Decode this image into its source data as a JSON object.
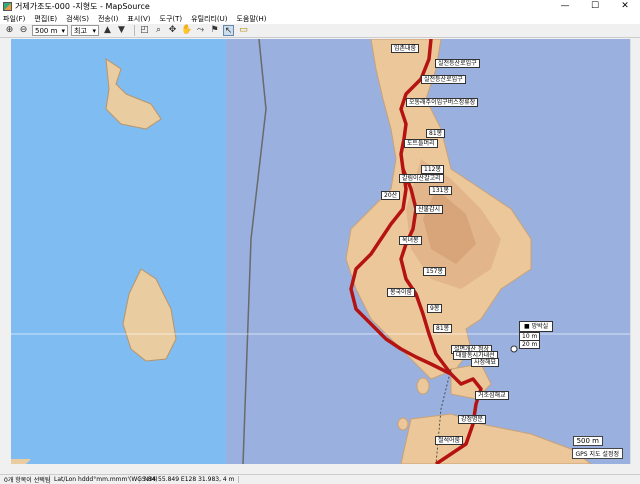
{
  "window": {
    "title": "거제가조도-000 -지형도 - MapSource",
    "min": "—",
    "max": "☐",
    "close": "✕"
  },
  "menu": [
    "파일(F)",
    "편집(E)",
    "검색(S)",
    "전송(I)",
    "표시(V)",
    "도구(T)",
    "유틸리티(U)",
    "도움말(H)"
  ],
  "toolbar": {
    "zoom_in": "⊕",
    "zoom_out": "⊖",
    "scale_value": "500 m",
    "detail_value": "최고"
  },
  "waypoints": [
    {
      "label": "임촌내룸"
    },
    {
      "label": "실전등산로입구"
    },
    {
      "label": "실전등산로입구"
    },
    {
      "label": "오동래주이입구버스정류장"
    },
    {
      "label": "81봉"
    },
    {
      "label": "도트들머리"
    },
    {
      "label": "112봉"
    },
    {
      "label": "갈림이산갈고리"
    },
    {
      "label": "131봉"
    },
    {
      "label": "20산"
    },
    {
      "label": "산불감시"
    },
    {
      "label": "옥녀봉"
    },
    {
      "label": "157봉"
    },
    {
      "label": "봉국이룸"
    },
    {
      "label": "9봉"
    },
    {
      "label": "81봉"
    },
    {
      "label": "설면개산 정상"
    },
    {
      "label": "대할동시가내선"
    },
    {
      "label": "사정해묘"
    },
    {
      "label": "거조섬해교"
    },
    {
      "label": "강정명문"
    },
    {
      "label": "철석어룸"
    }
  ],
  "callout": {
    "title": "망박실",
    "line1": "10 m",
    "line2": "20 m"
  },
  "map_overlay": {
    "scale": "500 m",
    "gps": "GPS 지도 설정정"
  },
  "status": {
    "selection": "0개 항목이 선택됨",
    "coord_format": "Lat/Lon hddd°mm.mmm'(WGS 84)",
    "position": "N34 55.849 E128 31.983, 4 m"
  }
}
